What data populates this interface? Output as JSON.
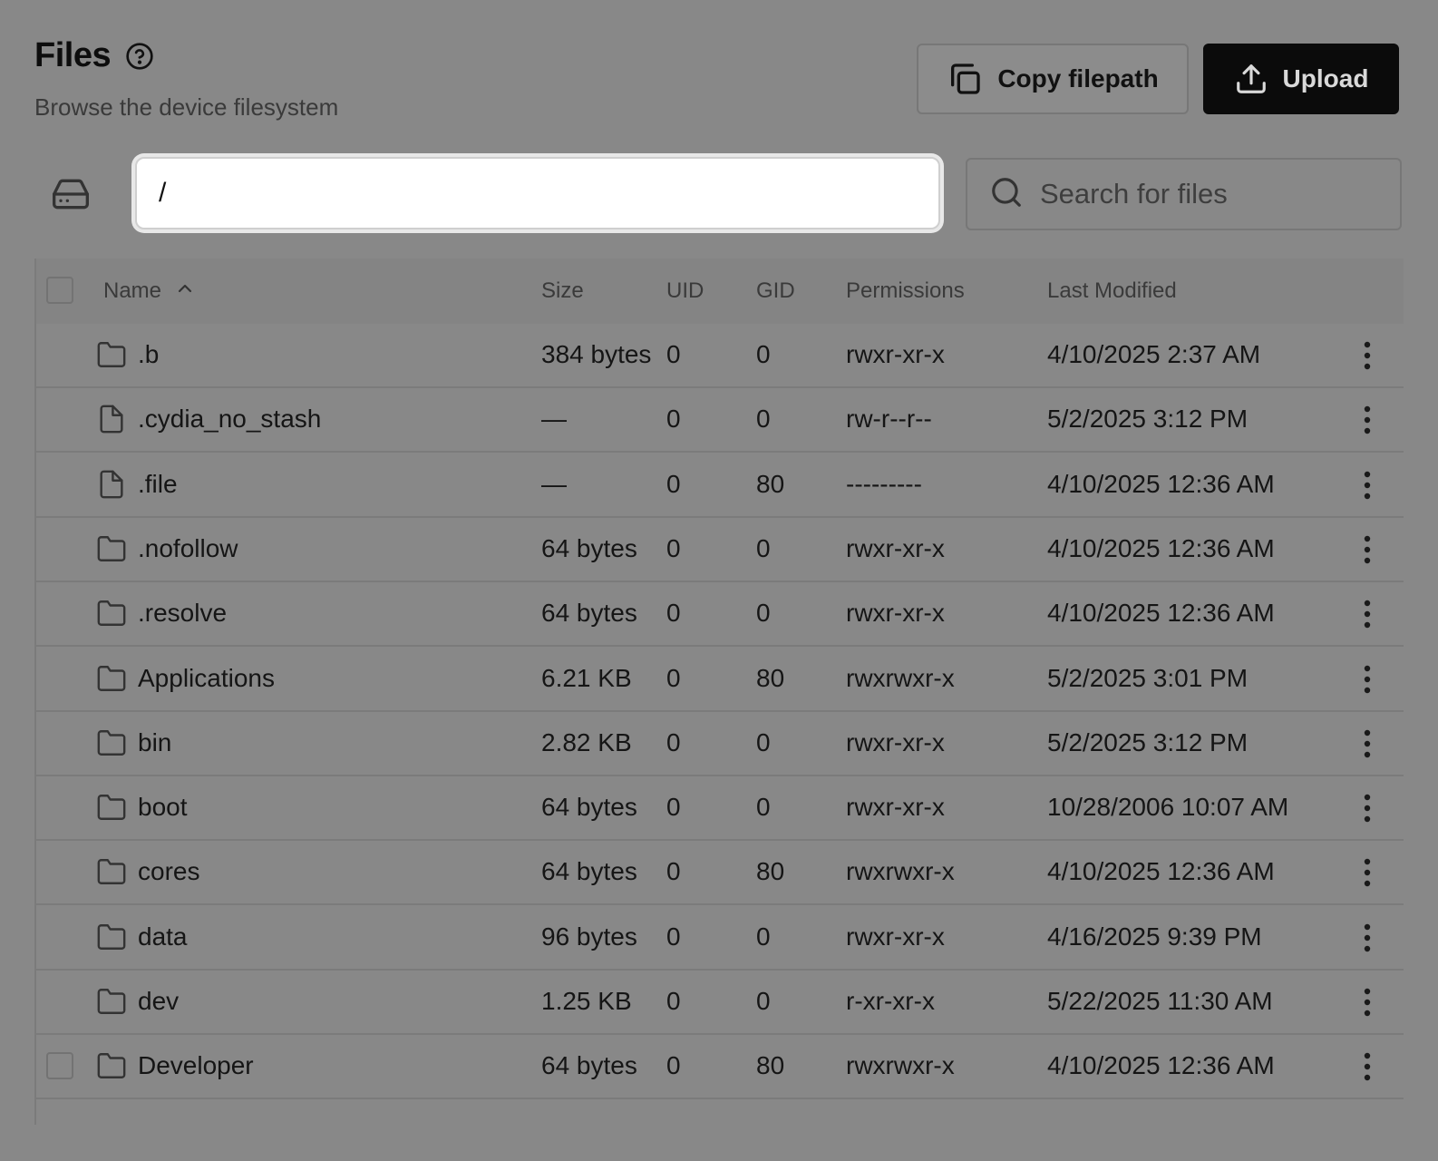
{
  "header": {
    "title": "Files",
    "subtitle": "Browse the device filesystem",
    "help_icon": "help-circle-icon"
  },
  "toolbar": {
    "copy_label": "Copy filepath",
    "upload_label": "Upload"
  },
  "path": {
    "value": "/"
  },
  "search": {
    "placeholder": "Search for files"
  },
  "table": {
    "columns": {
      "name": "Name",
      "size": "Size",
      "uid": "UID",
      "gid": "GID",
      "permissions": "Permissions",
      "modified": "Last Modified"
    },
    "sort": {
      "column": "Name",
      "direction": "ascending"
    },
    "rows": [
      {
        "name": ".b",
        "type": "folder",
        "size": "384 bytes",
        "uid": "0",
        "gid": "0",
        "permissions": "rwxr-xr-x",
        "modified": "4/10/2025 2:37 AM"
      },
      {
        "name": ".cydia_no_stash",
        "type": "file",
        "size": "—",
        "uid": "0",
        "gid": "0",
        "permissions": "rw-r--r--",
        "modified": "5/2/2025 3:12 PM"
      },
      {
        "name": ".file",
        "type": "file",
        "size": "—",
        "uid": "0",
        "gid": "80",
        "permissions": "---------",
        "modified": "4/10/2025 12:36 AM"
      },
      {
        "name": ".nofollow",
        "type": "folder",
        "size": "64 bytes",
        "uid": "0",
        "gid": "0",
        "permissions": "rwxr-xr-x",
        "modified": "4/10/2025 12:36 AM"
      },
      {
        "name": ".resolve",
        "type": "folder",
        "size": "64 bytes",
        "uid": "0",
        "gid": "0",
        "permissions": "rwxr-xr-x",
        "modified": "4/10/2025 12:36 AM"
      },
      {
        "name": "Applications",
        "type": "folder",
        "size": "6.21 KB",
        "uid": "0",
        "gid": "80",
        "permissions": "rwxrwxr-x",
        "modified": "5/2/2025 3:01 PM"
      },
      {
        "name": "bin",
        "type": "folder",
        "size": "2.82 KB",
        "uid": "0",
        "gid": "0",
        "permissions": "rwxr-xr-x",
        "modified": "5/2/2025 3:12 PM"
      },
      {
        "name": "boot",
        "type": "folder",
        "size": "64 bytes",
        "uid": "0",
        "gid": "0",
        "permissions": "rwxr-xr-x",
        "modified": "10/28/2006 10:07 AM"
      },
      {
        "name": "cores",
        "type": "folder",
        "size": "64 bytes",
        "uid": "0",
        "gid": "80",
        "permissions": "rwxrwxr-x",
        "modified": "4/10/2025 12:36 AM"
      },
      {
        "name": "data",
        "type": "folder",
        "size": "96 bytes",
        "uid": "0",
        "gid": "0",
        "permissions": "rwxr-xr-x",
        "modified": "4/16/2025 9:39 PM"
      },
      {
        "name": "dev",
        "type": "folder",
        "size": "1.25 KB",
        "uid": "0",
        "gid": "0",
        "permissions": "r-xr-xr-x",
        "modified": "5/22/2025 11:30 AM"
      },
      {
        "name": "Developer",
        "type": "folder",
        "size": "64 bytes",
        "uid": "0",
        "gid": "80",
        "permissions": "rwxrwxr-x",
        "modified": "4/10/2025 12:36 AM",
        "checkbox_visible": true
      }
    ]
  },
  "colors": {
    "background": "#888888",
    "primary_button": "#0b0b0b",
    "path_input_bg": "#ffffff"
  }
}
